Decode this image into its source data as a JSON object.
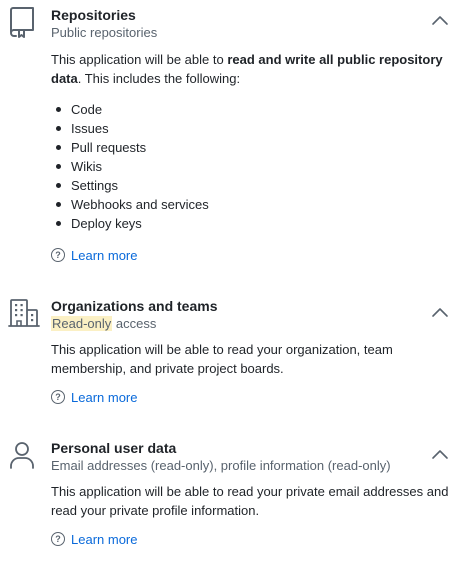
{
  "sections": [
    {
      "icon": "repo-icon",
      "title": "Repositories",
      "subtitle": "Public repositories",
      "desc_prefix": "This application will be able to ",
      "desc_bold": "read and write all public repository data",
      "desc_suffix": ". This includes the following:",
      "items": [
        "Code",
        "Issues",
        "Pull requests",
        "Wikis",
        "Settings",
        "Webhooks and services",
        "Deploy keys"
      ],
      "learn_more": "Learn more"
    },
    {
      "icon": "organization-icon",
      "title": "Organizations and teams",
      "subtitle_highlight": "Read-only",
      "subtitle_rest": " access",
      "description": "This application will be able to read your organization, team membership, and private project boards.",
      "learn_more": "Learn more"
    },
    {
      "icon": "person-icon",
      "title": "Personal user data",
      "subtitle": "Email addresses (read-only), profile information (read-only)",
      "description": "This application will be able to read your private email addresses and read your private profile information.",
      "learn_more": "Learn more"
    }
  ],
  "help_glyph": "?",
  "colors": {
    "text": "#1f2328",
    "muted": "#59636e",
    "link": "#0969da",
    "highlight": "#fbf0c4"
  }
}
